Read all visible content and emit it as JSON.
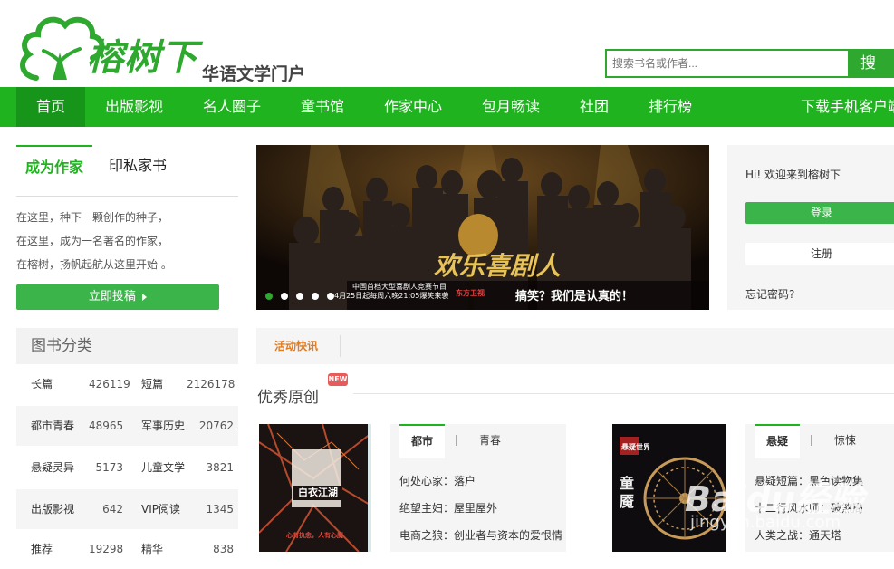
{
  "header": {
    "logo_title": "榕树下",
    "logo_subtitle": "华语文学门户",
    "search_placeholder": "搜索书名或作者...",
    "search_button": "搜 索"
  },
  "nav": {
    "items": [
      "首页",
      "出版影视",
      "名人圈子",
      "童书馆",
      "作家中心",
      "包月畅读",
      "社团",
      "排行榜"
    ],
    "download": "下载手机客户端"
  },
  "author": {
    "tab_active": "成为作家",
    "tab_other": "印私家书",
    "lines": [
      "在这里，种下一颗创作的种子，",
      "在这里，成为一名著名的作家，",
      "在榕树，扬帆起航从这里开始 。"
    ],
    "submit": "立即投稿"
  },
  "categories": {
    "title": "图书分类",
    "rows": [
      {
        "a": "长篇",
        "ac": "426119",
        "b": "短篇",
        "bc": "2126178"
      },
      {
        "a": "都市青春",
        "ac": "48965",
        "b": "军事历史",
        "bc": "20762"
      },
      {
        "a": "悬疑灵异",
        "ac": "5173",
        "b": "儿童文学",
        "bc": "3821"
      },
      {
        "a": "出版影视",
        "ac": "642",
        "b": "VIP阅读",
        "bc": "1345"
      },
      {
        "a": "推荐",
        "ac": "19298",
        "b": "精华",
        "bc": "838"
      }
    ]
  },
  "banner": {
    "show_title": "欢乐喜剧人",
    "caption1": "中国首档大型喜剧人竞赛节目",
    "caption2": "4月25日起每周六晚21:05爆笑来袭",
    "channel": "东方卫视",
    "slogan": "搞笑？我们是认真的！"
  },
  "login": {
    "welcome": "Hi! 欢迎来到榕树下",
    "login": "登录",
    "register": "注册",
    "forgot": "忘记密码?"
  },
  "activity": {
    "label": "活动快讯"
  },
  "section": {
    "title": "优秀原创",
    "badge": "NEW"
  },
  "book1": {
    "title": "白衣江湖",
    "tagline": "心有执念，人有心魔"
  },
  "book2": {
    "title": "童魇",
    "publisher": "悬疑世界"
  },
  "mid_tabs": {
    "tab_a": "都市",
    "tab_b": "青春",
    "items": [
      {
        "cat": "何处心家：",
        "title": "落户"
      },
      {
        "cat": "绝望主妇：",
        "title": "屋里屋外"
      },
      {
        "cat": "电商之狼：",
        "title": "创业者与资本的爱恨情"
      }
    ]
  },
  "right_tabs": {
    "tab_a": "悬疑",
    "tab_b": "惊悚",
    "items": [
      {
        "cat": "悬疑短篇：",
        "title": "黑色读物集"
      },
      {
        "cat": "十二行风水师：",
        "title": "破煞局"
      },
      {
        "cat": "人类之战：",
        "title": "通天塔"
      }
    ]
  },
  "watermark": {
    "brand": "Baidu经验",
    "url": "jingyan.baidu.com"
  },
  "colors": {
    "brand_green": "#1fb31f",
    "button_green": "#3bb54a",
    "activity_orange": "#e07b22",
    "badge_red": "#e85b5b"
  }
}
